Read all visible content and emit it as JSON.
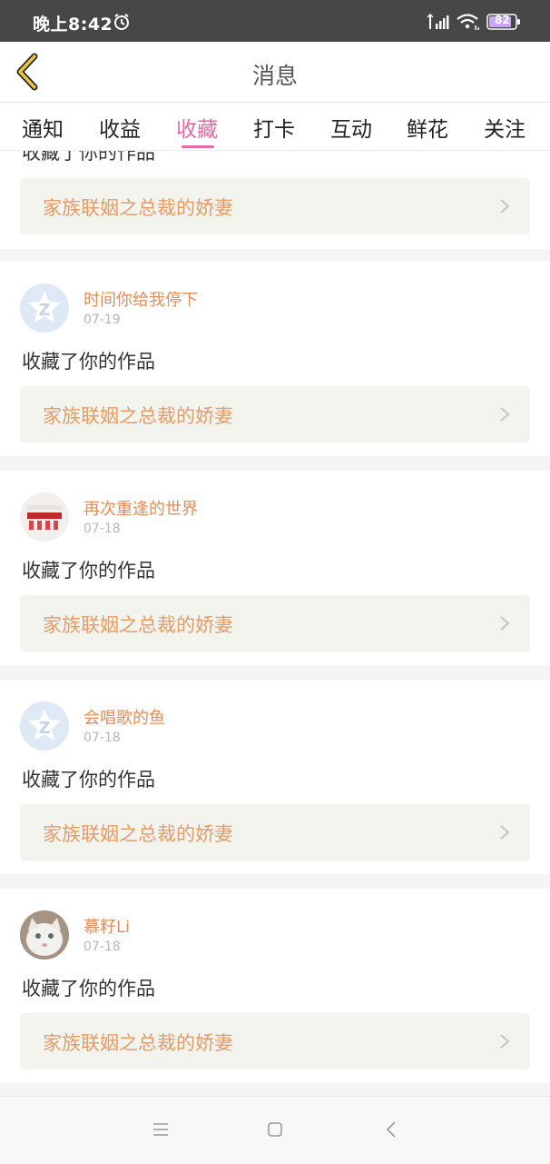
{
  "status_bar": {
    "time": "晚上8:42",
    "battery": "82",
    "icons": [
      "alarm-icon",
      "signal-icon",
      "wifi-icon",
      "battery-icon"
    ]
  },
  "header": {
    "title": "消息",
    "back_icon": "chevron-left-icon",
    "back_color": "#e8c640"
  },
  "tabs": [
    {
      "label": "通知",
      "active": false
    },
    {
      "label": "收益",
      "active": false
    },
    {
      "label": "收藏",
      "active": true
    },
    {
      "label": "打卡",
      "active": false
    },
    {
      "label": "互动",
      "active": false
    },
    {
      "label": "鲜花",
      "active": false
    },
    {
      "label": "关注",
      "active": false
    }
  ],
  "accent_color": "#e86aa2",
  "feed": {
    "partial_card": {
      "action": "收藏了你的作品",
      "work_title": "家族联姻之总裁的娇妻"
    },
    "items": [
      {
        "user": "时间你给我停下",
        "date": "07-19",
        "action": "收藏了你的作品",
        "work_title": "家族联姻之总裁的娇妻",
        "avatar": "default-avatar-icon"
      },
      {
        "user": "再次重逢的世界",
        "date": "07-18",
        "action": "收藏了你的作品",
        "work_title": "家族联姻之总裁的娇妻",
        "avatar": "photo-avatar"
      },
      {
        "user": "会唱歌的鱼",
        "date": "07-18",
        "action": "收藏了你的作品",
        "work_title": "家族联姻之总裁的娇妻",
        "avatar": "default-avatar-icon"
      },
      {
        "user": "慕籽Li",
        "date": "07-18",
        "action": "收藏了你的作品",
        "work_title": "家族联姻之总裁的娇妻",
        "avatar": "cat-avatar"
      }
    ]
  },
  "nav_bar": {
    "icons": [
      "menu-icon",
      "home-icon",
      "back-icon"
    ]
  }
}
